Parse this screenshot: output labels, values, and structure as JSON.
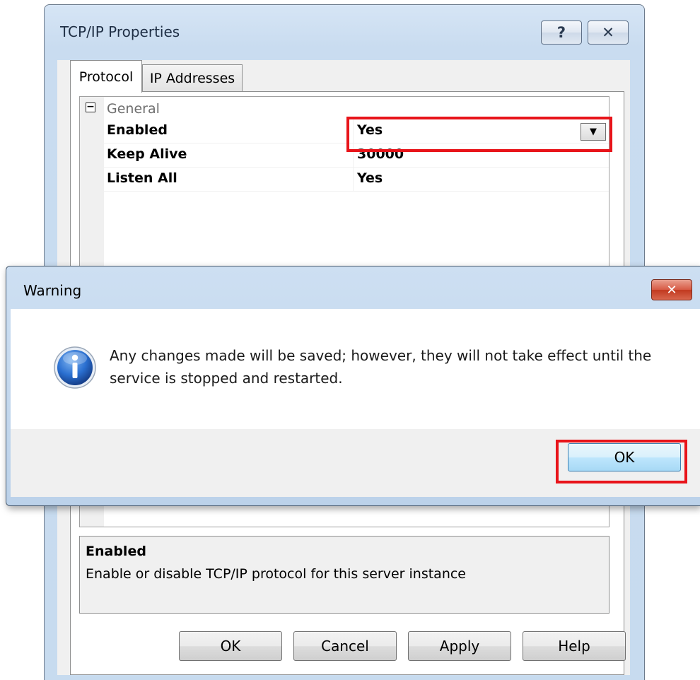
{
  "main_dialog": {
    "title": "TCP/IP Properties",
    "help_glyph": "?",
    "close_glyph": "✕",
    "tabs": [
      {
        "label": "Protocol",
        "selected": true
      },
      {
        "label": "IP Addresses",
        "selected": false
      }
    ],
    "grid": {
      "category": {
        "label": "General",
        "expander": "−"
      },
      "properties": [
        {
          "name": "Enabled",
          "value": "Yes"
        },
        {
          "name": "Keep Alive",
          "value": "30000"
        },
        {
          "name": "Listen All",
          "value": "Yes"
        }
      ],
      "dropdown_glyph": "▼"
    },
    "description": {
      "title": "Enabled",
      "text": "Enable or disable TCP/IP protocol for this server instance"
    },
    "buttons": {
      "ok": "OK",
      "cancel": "Cancel",
      "apply": "Apply",
      "help": "Help"
    }
  },
  "warning_dialog": {
    "title": "Warning",
    "close_glyph": "✕",
    "icon": "info-icon",
    "message": "Any changes made will be saved; however, they will not take effect until the service is stopped and restarted.",
    "ok_label": "OK"
  },
  "colors": {
    "highlight": "#e8141a",
    "title_bar": "#c9dcf0",
    "close_red": "#c1391f",
    "info_blue": "#1f5fb8"
  }
}
